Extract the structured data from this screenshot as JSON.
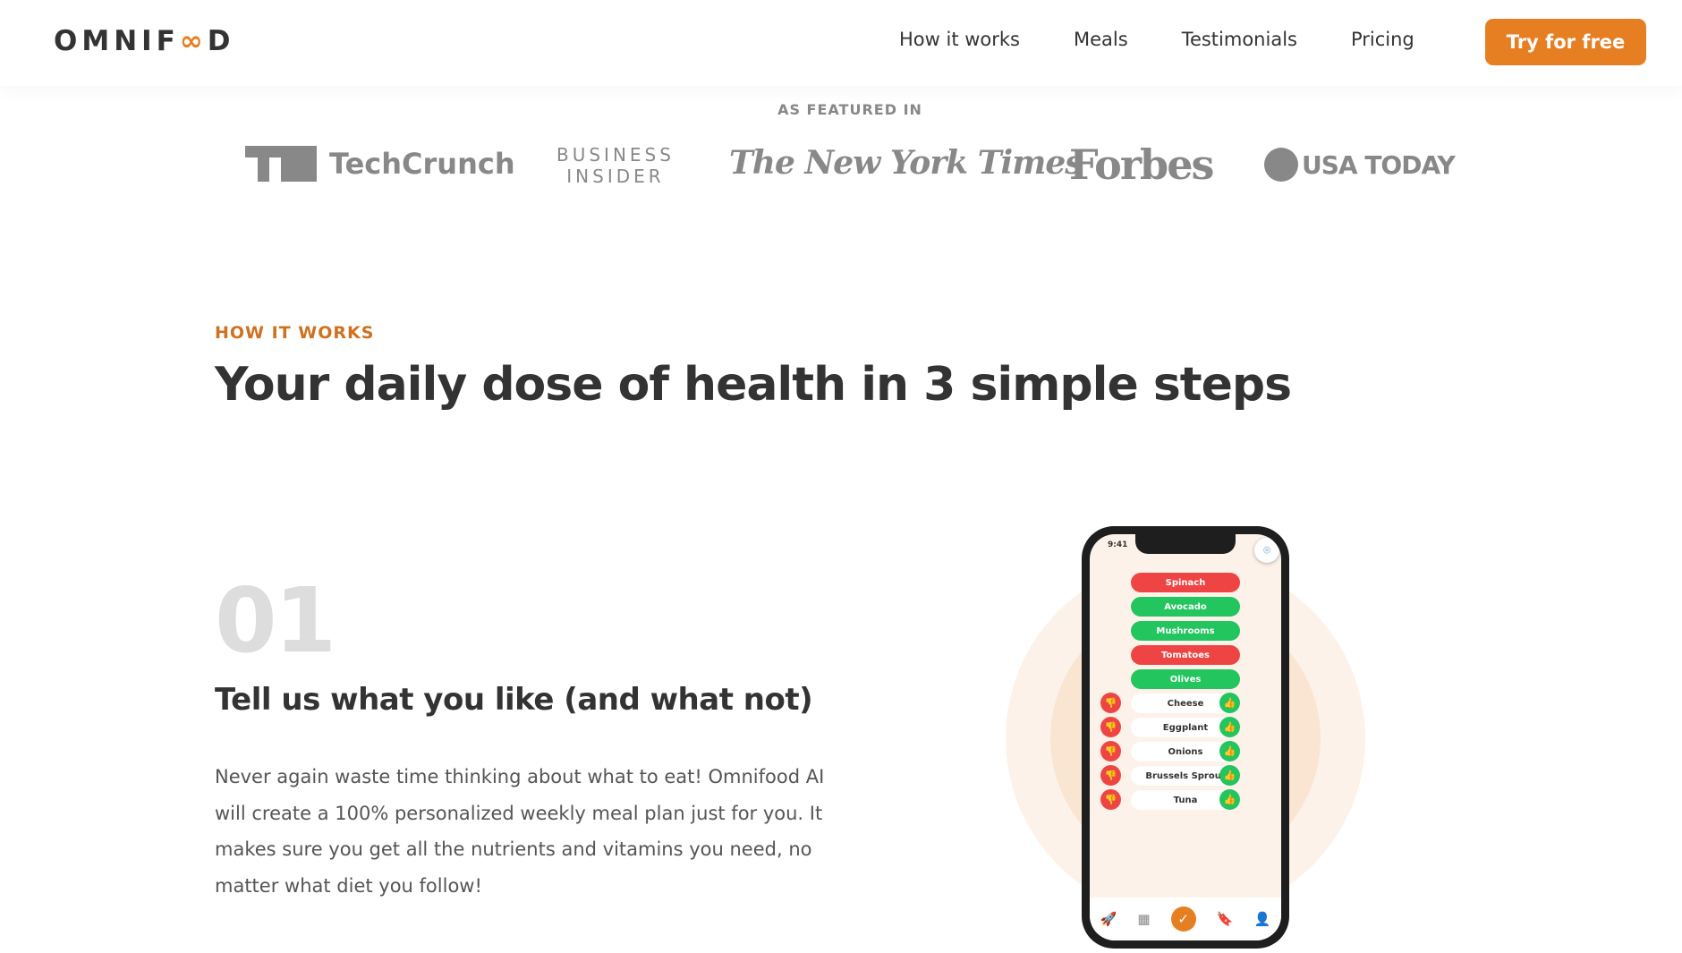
{
  "nav": {
    "logo": "OMNIFOOD",
    "links": [
      "How it works",
      "Meals",
      "Testimonials",
      "Pricing"
    ],
    "cta": "Try for free"
  },
  "featured": {
    "label": "AS FEATURED IN",
    "logos": [
      "TechCrunch",
      "BUSINESS INSIDER",
      "The New York Times",
      "Forbes",
      "USA TODAY"
    ]
  },
  "section": {
    "subheading": "HOW IT WORKS",
    "heading": "Your daily dose of health in 3 simple steps"
  },
  "step": {
    "number": "01",
    "title": "Tell us what you like (and what not)",
    "description": "Never again waste time thinking about what to eat! Omnifood AI will create a 100% personalized weekly meal plan just for you. It makes sure you get all the nutrients and vitamins you need, no matter what diet you follow!"
  },
  "phone": {
    "time": "9:41",
    "chosen": [
      {
        "label": "Spinach",
        "status": "disliked"
      },
      {
        "label": "Avocado",
        "status": "liked"
      },
      {
        "label": "Mushrooms",
        "status": "liked"
      },
      {
        "label": "Tomatoes",
        "status": "disliked"
      },
      {
        "label": "Olives",
        "status": "liked"
      }
    ],
    "pending": [
      "Cheese",
      "Eggplant",
      "Onions",
      "Brussels Sprout",
      "Tuna"
    ]
  },
  "colors": {
    "accent": "#e67e22",
    "liked": "#22c55e",
    "disliked": "#ef4444"
  }
}
